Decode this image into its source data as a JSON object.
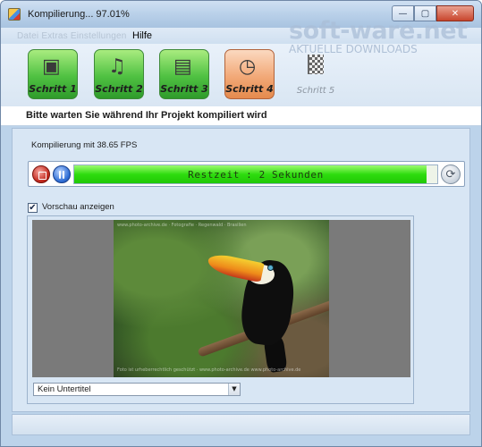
{
  "window": {
    "title": "Kompilierung... 97.01%",
    "buttons": {
      "minimize": "—",
      "maximize": "▢",
      "close": "✕"
    }
  },
  "menu": {
    "faded_text": "Datei  Extras  Einstellungen",
    "help": "Hilfe"
  },
  "watermark": {
    "main": "soft-ware.net",
    "sub": "AKTUELLE DOWNLOADS"
  },
  "steps": [
    {
      "label": "Schritt 1",
      "icon": "photos-icon",
      "state": "done"
    },
    {
      "label": "Schritt 2",
      "icon": "music-icon",
      "state": "done"
    },
    {
      "label": "Schritt 3",
      "icon": "monitor-icon",
      "state": "done"
    },
    {
      "label": "Schritt 4",
      "icon": "clock-icon",
      "state": "active"
    },
    {
      "label": "Schritt 5",
      "icon": "checkered-flag-icon",
      "state": "pending"
    }
  ],
  "subheader": "Bitte warten Sie während Ihr Projekt kompiliert wird",
  "fps_text": "Kompilierung mit 38.65 FPS",
  "progress": {
    "text": "Restzeit :  2 Sekunden",
    "percent": 97.01,
    "color": "#2edc0f"
  },
  "preview_checkbox": {
    "label": "Vorschau anzeigen",
    "checked": true
  },
  "preview_captions": {
    "top": "www.photo-archive.de · Fotografie · Regenwald · Brasilien",
    "bottom": "Foto ist urheberrechtlich geschützt · www.photo-archive.de        www.photo-archive.de"
  },
  "subtitle_select": {
    "value": "Kein Untertitel"
  }
}
